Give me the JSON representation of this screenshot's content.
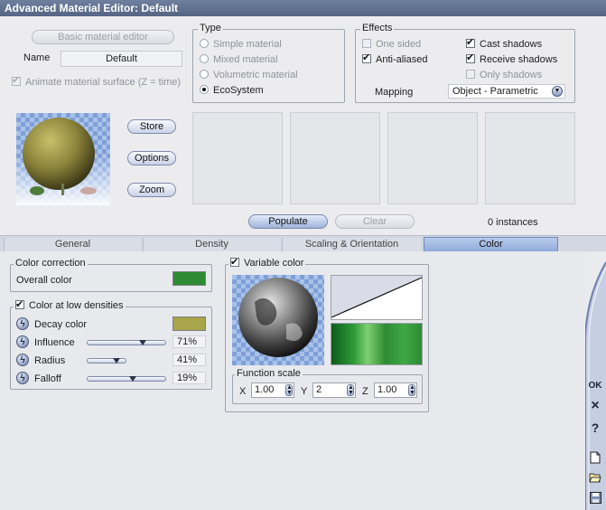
{
  "window": {
    "title": "Advanced Material Editor: Default"
  },
  "basic_editor_button": "Basic material editor",
  "name": {
    "label": "Name",
    "value": "Default"
  },
  "animate_surface": {
    "label": "Animate material surface (Z = time)",
    "checked": true,
    "enabled": false
  },
  "type_group": {
    "title": "Type",
    "options": [
      "Simple material",
      "Mixed material",
      "Volumetric material",
      "EcoSystem"
    ],
    "selected": "EcoSystem"
  },
  "effects_group": {
    "title": "Effects",
    "one_sided": "One sided",
    "anti_aliased": "Anti-aliased",
    "cast_shadows": "Cast shadows",
    "receive_shadows": "Receive shadows",
    "only_shadows": "Only shadows",
    "mapping_label": "Mapping",
    "mapping_value": "Object - Parametric"
  },
  "preview_buttons": {
    "store": "Store",
    "options": "Options",
    "zoom": "Zoom"
  },
  "populate_button": "Populate",
  "clear_button": "Clear",
  "instances": "0 instances",
  "tabs": [
    "General",
    "Density",
    "Scaling & Orientation",
    "Color"
  ],
  "selected_tab": "Color",
  "color_correction": {
    "title": "Color correction",
    "overall_label": "Overall color",
    "overall_color": "#2e8b34"
  },
  "low_density": {
    "title": "Color at low densities",
    "decay_label": "Decay color",
    "decay_color": "#a9a54a",
    "influence_label": "Influence",
    "influence_value": "71%",
    "radius_label": "Radius",
    "radius_value": "41%",
    "falloff_label": "Falloff",
    "falloff_value": "19%"
  },
  "variable_color": {
    "title": "Variable color",
    "function_scale": "Function scale",
    "x_label": "X",
    "x_value": "1.00",
    "y_label": "Y",
    "y_value": "2",
    "z_label": "Z",
    "z_value": "1.00"
  },
  "side_buttons": {
    "ok": "OK",
    "close": "×",
    "help": "?"
  }
}
